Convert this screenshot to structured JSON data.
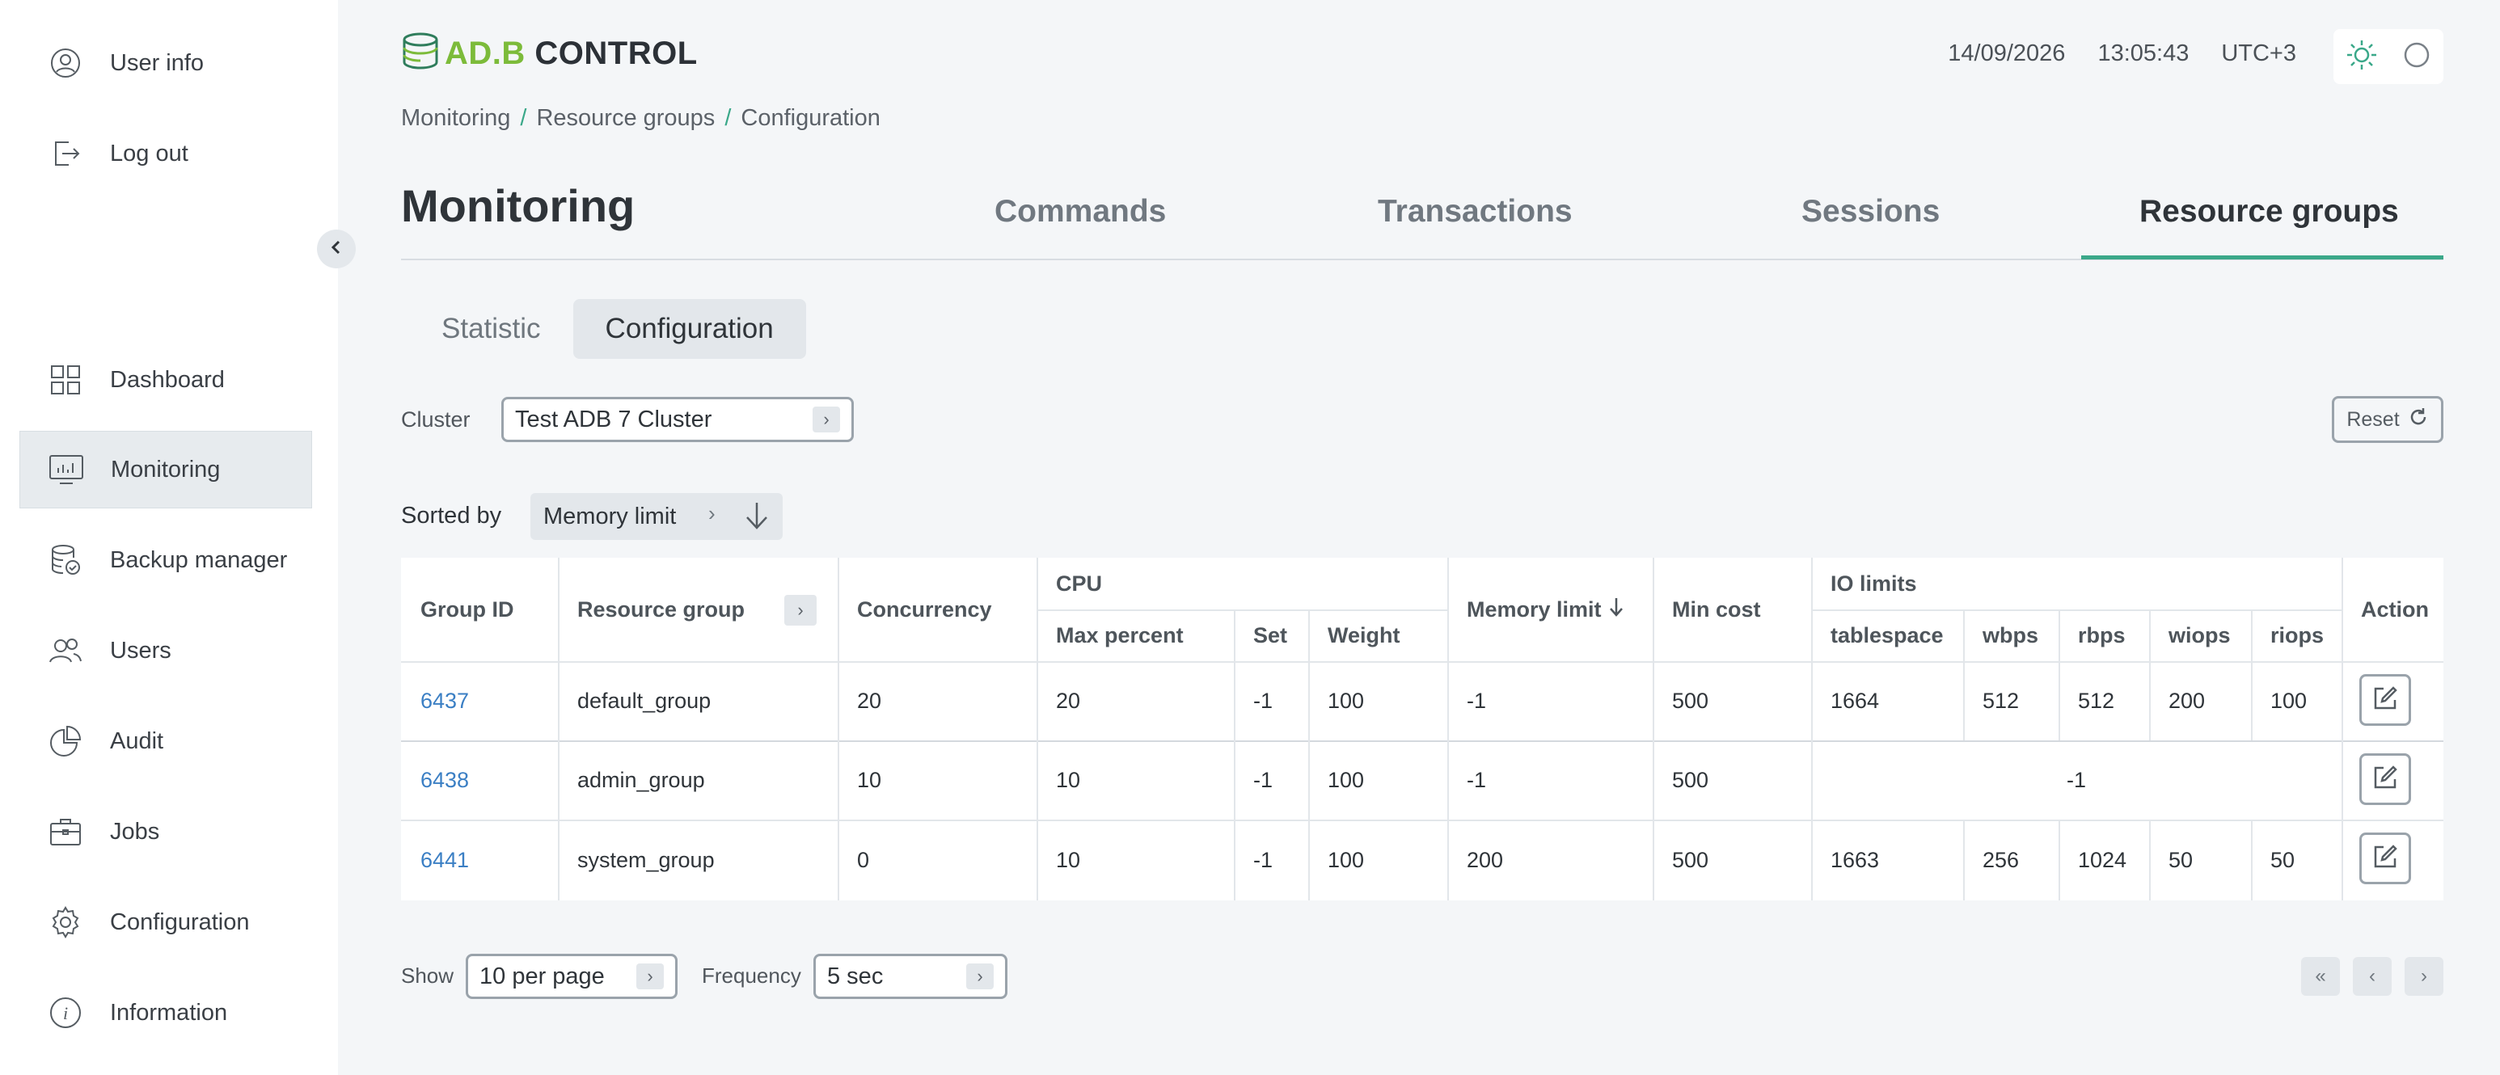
{
  "sidebar": {
    "user_info": "User info",
    "logout": "Log out",
    "items": [
      {
        "label": "Dashboard"
      },
      {
        "label": "Monitoring"
      },
      {
        "label": "Backup manager"
      },
      {
        "label": "Users"
      },
      {
        "label": "Audit"
      },
      {
        "label": "Jobs"
      },
      {
        "label": "Configuration"
      },
      {
        "label": "Information"
      }
    ]
  },
  "header": {
    "logo_part1": "AD.B",
    "logo_part2": " CONTROL",
    "date": "14/09/2026",
    "time": "13:05:43",
    "timezone": "UTC+3"
  },
  "breadcrumb": [
    "Monitoring",
    "Resource groups",
    "Configuration"
  ],
  "page_title": "Monitoring",
  "tabs": [
    "Commands",
    "Transactions",
    "Sessions",
    "Resource groups"
  ],
  "subtabs": [
    "Statistic",
    "Configuration"
  ],
  "cluster": {
    "label": "Cluster",
    "value": "Test ADB 7 Cluster"
  },
  "reset_label": "Reset",
  "sort": {
    "label": "Sorted by",
    "value": "Memory limit"
  },
  "table": {
    "headers": {
      "group_id": "Group ID",
      "resource_group": "Resource group",
      "concurrency": "Concurrency",
      "cpu": "CPU",
      "max_percent": "Max percent",
      "set": "Set",
      "weight": "Weight",
      "memory_limit": "Memory limit",
      "min_cost": "Min cost",
      "io_limits": "IO limits",
      "tablespace": "tablespace",
      "wbps": "wbps",
      "rbps": "rbps",
      "wiops": "wiops",
      "riops": "riops",
      "action": "Action"
    },
    "rows": [
      {
        "id": "6437",
        "group": "default_group",
        "concurrency": "20",
        "max_percent": "20",
        "set": "-1",
        "weight": "100",
        "memory_limit": "-1",
        "min_cost": "500",
        "tablespace": "1664",
        "wbps": "512",
        "rbps": "512",
        "wiops": "200",
        "riops": "100"
      },
      {
        "id": "6438",
        "group": "admin_group",
        "concurrency": "10",
        "max_percent": "10",
        "set": "-1",
        "weight": "100",
        "memory_limit": "-1",
        "min_cost": "500",
        "io_merged": "-1"
      },
      {
        "id": "6441",
        "group": "system_group",
        "concurrency": "0",
        "max_percent": "10",
        "set": "-1",
        "weight": "100",
        "memory_limit": "200",
        "min_cost": "500",
        "tablespace": "1663",
        "wbps": "256",
        "rbps": "1024",
        "wiops": "50",
        "riops": "50"
      }
    ]
  },
  "footer": {
    "show_label": "Show",
    "show_value": "10 per page",
    "frequency_label": "Frequency",
    "frequency_value": "5 sec"
  }
}
